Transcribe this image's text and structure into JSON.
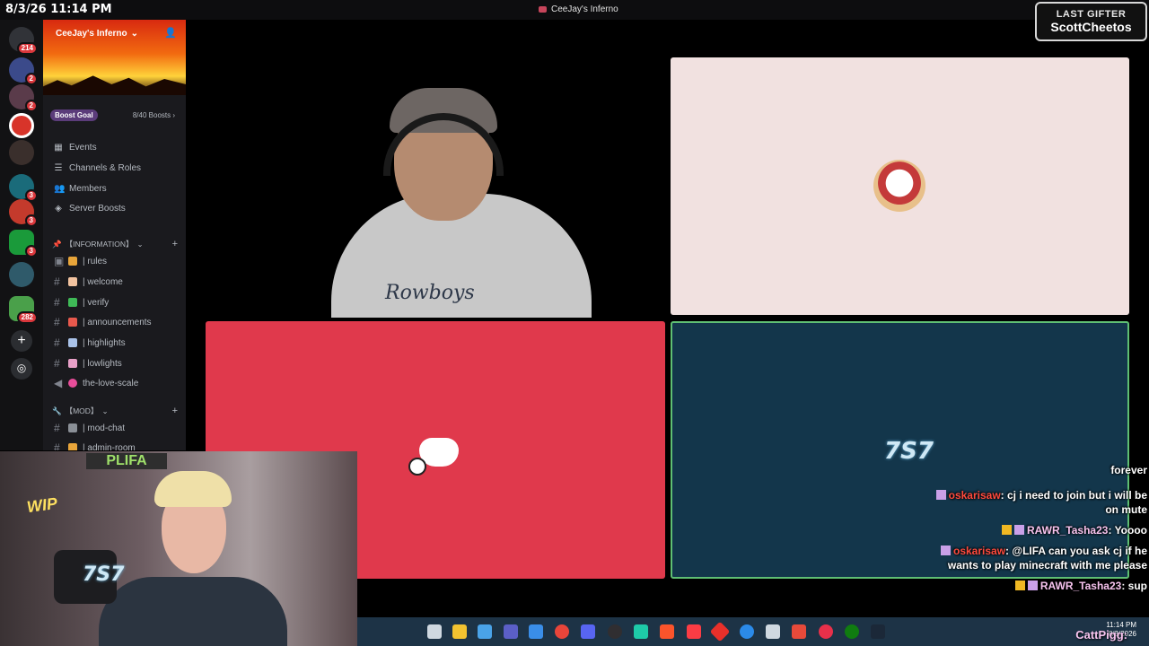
{
  "timestamp": "8/3/26 11:14 PM",
  "window_title": "CeeJay's Inferno",
  "gifter": {
    "label": "LAST GIFTER",
    "name": "ScottCheetos"
  },
  "rail": [
    {
      "icon": "discord-home-icon",
      "badge": "214"
    },
    {
      "icon": "server-icon",
      "badge": "2"
    },
    {
      "icon": "server-icon",
      "badge": "2"
    },
    {
      "icon": "server-icon",
      "badge": ""
    },
    {
      "icon": "server-icon",
      "badge": ""
    },
    {
      "icon": "server-icon",
      "badge": "3"
    },
    {
      "icon": "server-icon",
      "badge": "3"
    },
    {
      "icon": "server-icon",
      "badge": "3"
    },
    {
      "icon": "server-icon",
      "badge": ""
    },
    {
      "icon": "server-icon",
      "badge": "282"
    }
  ],
  "sidebar": {
    "server_name": "CeeJay's Inferno",
    "boost_goal": "Boost Goal",
    "boost_count": "8/40 Boosts",
    "nav": [
      {
        "label": "Events",
        "icon": "calendar-icon"
      },
      {
        "label": "Channels & Roles",
        "icon": "list-icon"
      },
      {
        "label": "Members",
        "icon": "members-icon"
      },
      {
        "label": "Server Boosts",
        "icon": "boost-icon"
      }
    ],
    "category_info": "【INFORMATION】",
    "channels_info": [
      {
        "name": "| rules",
        "color": "#e8a53a"
      },
      {
        "name": "| welcome",
        "color": "#f2c3a0"
      },
      {
        "name": "| verify",
        "color": "#3fba57"
      },
      {
        "name": "| announcements",
        "color": "#e8594d"
      },
      {
        "name": "| highlights",
        "color": "#a9c2e8"
      },
      {
        "name": "| lowlights",
        "color": "#e8a0c8"
      },
      {
        "name": "the-love-scale",
        "color": "#e84d9a"
      }
    ],
    "category_mod": "【MOD】",
    "channels_mod": [
      {
        "name": "| mod-chat",
        "color": "#b5bac1"
      },
      {
        "name": "| admin-room",
        "color": "#e8a53a"
      }
    ]
  },
  "tiles": {
    "shirt_text": "Rowboys",
    "t57": "7S7"
  },
  "webcam": {
    "sign": "PLIFA",
    "wip": "WIP"
  },
  "chat": [
    {
      "user": "",
      "text": "forever",
      "user_color": ""
    },
    {
      "user": "oskarisaw",
      "text": ": cj i need to join but i will be on mute",
      "user_color": "red"
    },
    {
      "user": "RAWR_Tasha23",
      "text": ": Yoooo",
      "user_color": "pink"
    },
    {
      "user": "oskarisaw",
      "text": ": @LIFA can you ask cj if he wants to play minecraft with me please",
      "user_color": "red"
    },
    {
      "user": "RAWR_Tasha23",
      "text": ": sup",
      "user_color": "pink"
    }
  ],
  "taskbar": {
    "time": "11:14 PM",
    "date": "8/3/2026",
    "overlay_user": "CattPigg:",
    "icons": [
      "files-icon",
      "folder-icon",
      "copilot-icon",
      "teams-icon",
      "store-icon",
      "chrome-icon",
      "discord-icon",
      "obs-icon",
      "app-icon",
      "brave-icon",
      "music-icon",
      "app-icon",
      "help-icon",
      "app-icon",
      "app-icon",
      "app-icon",
      "xbox-icon",
      "steam-icon"
    ]
  }
}
